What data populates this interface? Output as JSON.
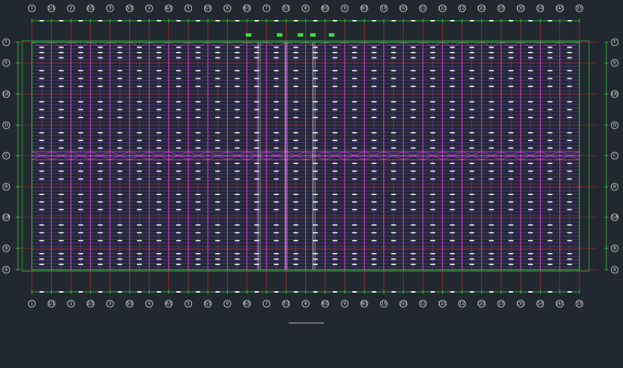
{
  "drawing": {
    "plan_title": "",
    "column_grid_labels": [
      "1",
      "1/1",
      "2",
      "2/1",
      "3",
      "3/1",
      "4",
      "4/1",
      "5",
      "5/1",
      "6",
      "6/1",
      "7",
      "7/1",
      "8",
      "8/1",
      "9",
      "9/1",
      "10",
      "10/1",
      "11",
      "11/1",
      "12",
      "12/1",
      "13",
      "13/1",
      "14",
      "14/1",
      "15"
    ],
    "row_grid_labels": [
      "F",
      "E",
      "1/D",
      "D",
      "C",
      "B",
      "1/A",
      "B",
      "A"
    ],
    "colors": {
      "background": "#212830",
      "purlin": "#7f3fd0",
      "roof_brace": "#ff3cff",
      "column_line": "#e52a2a",
      "steel_frame": "#3cdc3c",
      "annotation": "#ffffff",
      "truss": "#e6e6e6"
    }
  }
}
